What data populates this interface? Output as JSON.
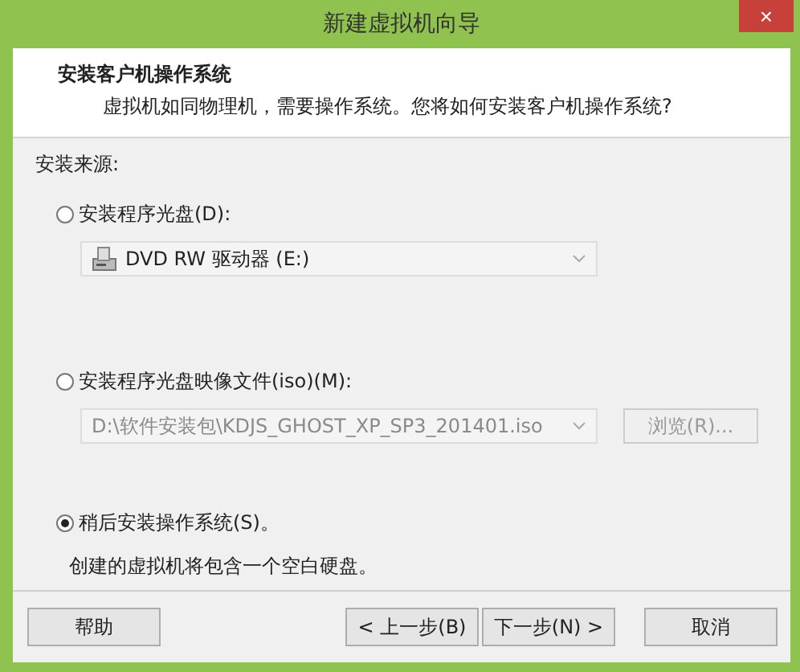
{
  "window": {
    "title": "新建虚拟机向导",
    "close": "×"
  },
  "header": {
    "title": "安装客户机操作系统",
    "subtitle": "虚拟机如同物理机，需要操作系统。您将如何安装客户机操作系统?"
  },
  "source_label": "安装来源:",
  "options": [
    {
      "kind": "disc",
      "label": "安装程序光盘(D):",
      "selected": false,
      "value": "DVD RW 驱动器 (E:)",
      "disabled": false
    },
    {
      "kind": "iso",
      "label": "安装程序光盘映像文件(iso)(M):",
      "selected": false,
      "value": "D:\\软件安装包\\KDJS_GHOST_XP_SP3_201401.iso",
      "disabled": true,
      "browse": "浏览(R)..."
    },
    {
      "kind": "later",
      "label": "稍后安装操作系统(S)。",
      "selected": true,
      "note": "创建的虚拟机将包含一个空白硬盘。"
    }
  ],
  "buttons": {
    "help": "帮助",
    "back": "< 上一步(B)",
    "next": "下一步(N) >",
    "cancel": "取消"
  }
}
